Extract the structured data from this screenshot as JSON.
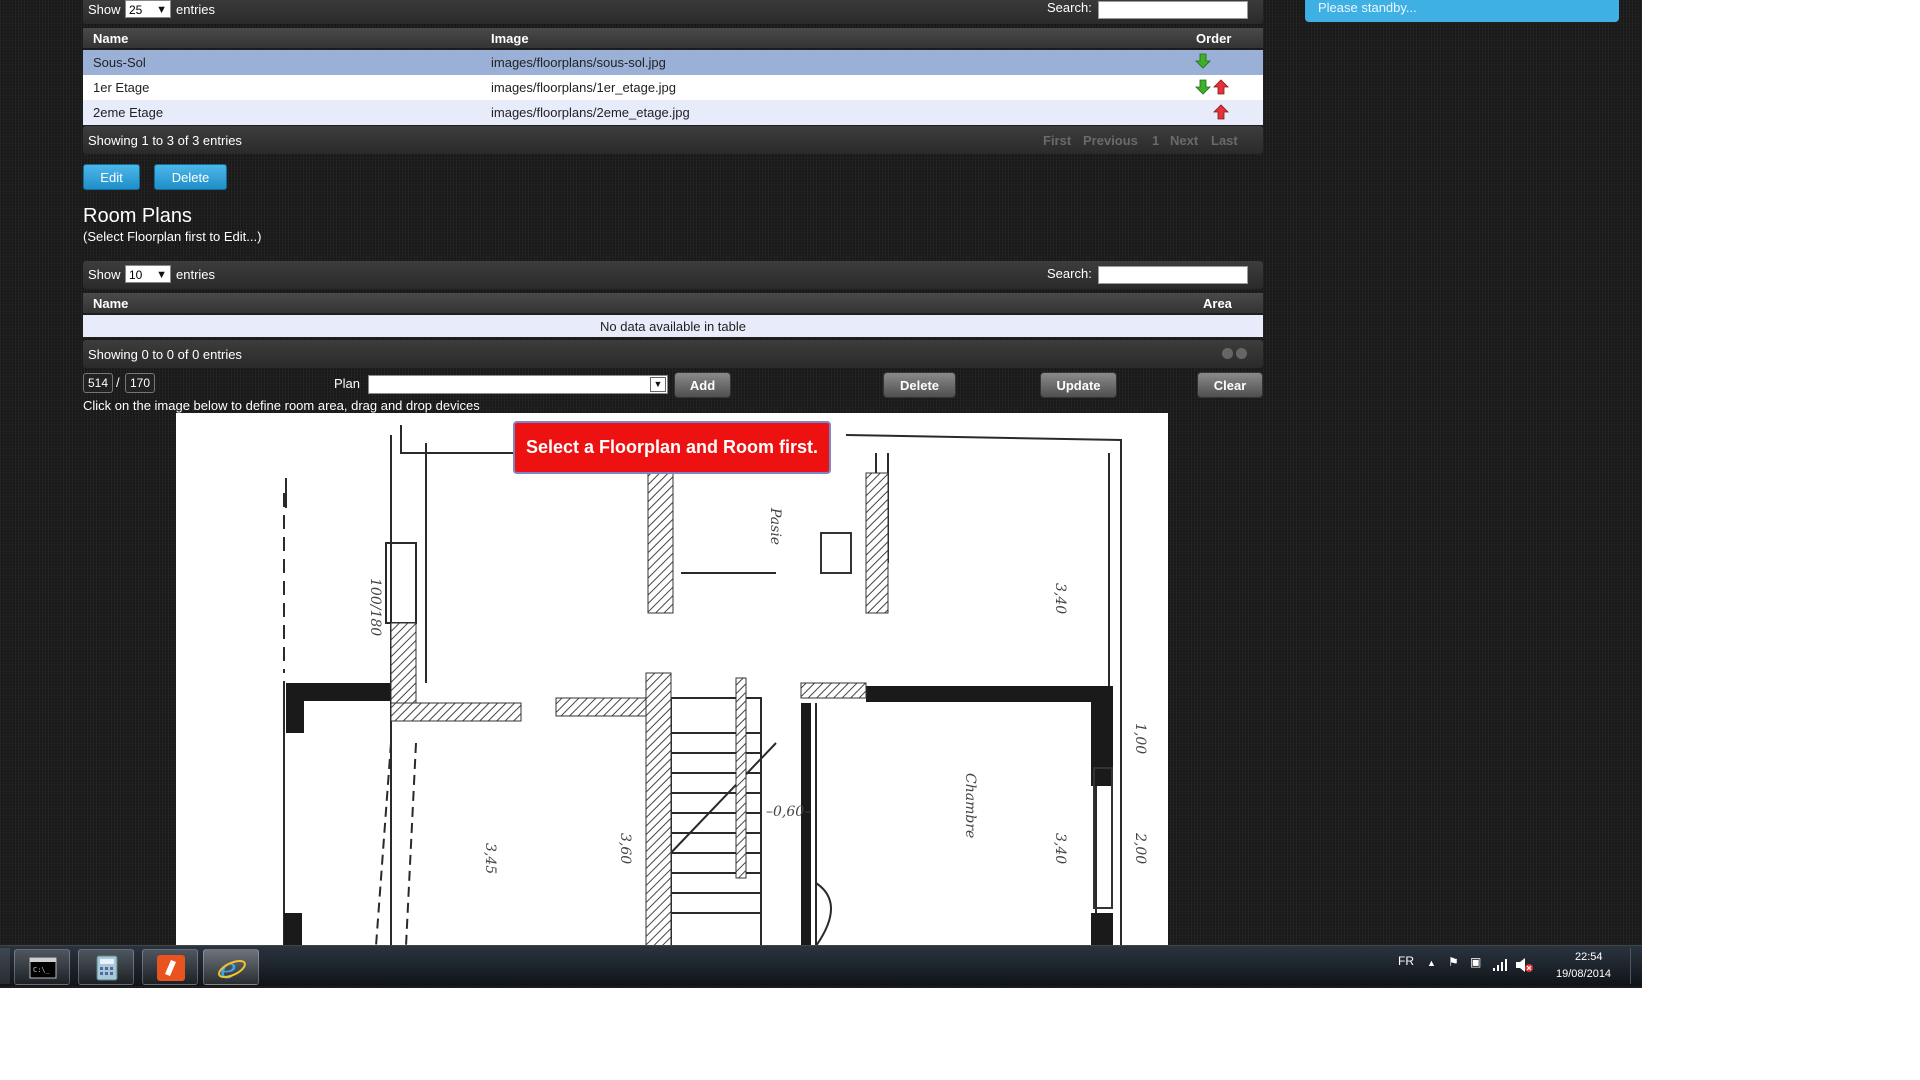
{
  "floorplans_table": {
    "show_label": "Show",
    "entries_value": "25",
    "entries_label": "entries",
    "search_label": "Search:",
    "columns": [
      "Name",
      "Image",
      "Order"
    ],
    "rows": [
      {
        "name": "Sous-Sol",
        "image": "images/floorplans/sous-sol.jpg",
        "order": [
          "down"
        ]
      },
      {
        "name": "1er Etage",
        "image": "images/floorplans/1er_etage.jpg",
        "order": [
          "down",
          "up"
        ]
      },
      {
        "name": "2eme Etage",
        "image": "images/floorplans/2eme_etage.jpg",
        "order": [
          "up"
        ]
      }
    ],
    "info": "Showing 1 to 3 of 3 entries",
    "pager": {
      "first": "First",
      "previous": "Previous",
      "page": "1",
      "next": "Next",
      "last": "Last"
    }
  },
  "floorplan_actions": {
    "edit": "Edit",
    "delete": "Delete"
  },
  "room_plans": {
    "title": "Room Plans",
    "subtitle": "(Select Floorplan first to Edit...)",
    "show_label": "Show",
    "entries_value": "10",
    "entries_label": "entries",
    "search_label": "Search:",
    "columns": [
      "Name",
      "Area"
    ],
    "empty_text": "No data available in table",
    "info": "Showing 0 to 0 of 0 entries"
  },
  "editor": {
    "coord_x": "514",
    "coord_sep": "/",
    "coord_y": "170",
    "plan_label": "Plan",
    "plan_value": "",
    "add": "Add",
    "delete": "Delete",
    "update": "Update",
    "clear": "Clear",
    "hint": "Click on the image below to define room area, drag and drop devices",
    "banner": "Select a Floorplan and Room first."
  },
  "notification": {
    "text": "Please standby..."
  },
  "taskbar": {
    "apps": [
      "command-prompt-icon",
      "calculator-icon",
      "app-icon",
      "internet-explorer-icon"
    ],
    "language": "FR",
    "time": "22:54",
    "date": "19/08/2014"
  },
  "colors": {
    "selected_row": "#9bb0d6",
    "banner_red": "#ee1111",
    "standby_blue": "#3fb0e3",
    "arrow_down": "#3fae2a",
    "arrow_up": "#e0343a"
  }
}
